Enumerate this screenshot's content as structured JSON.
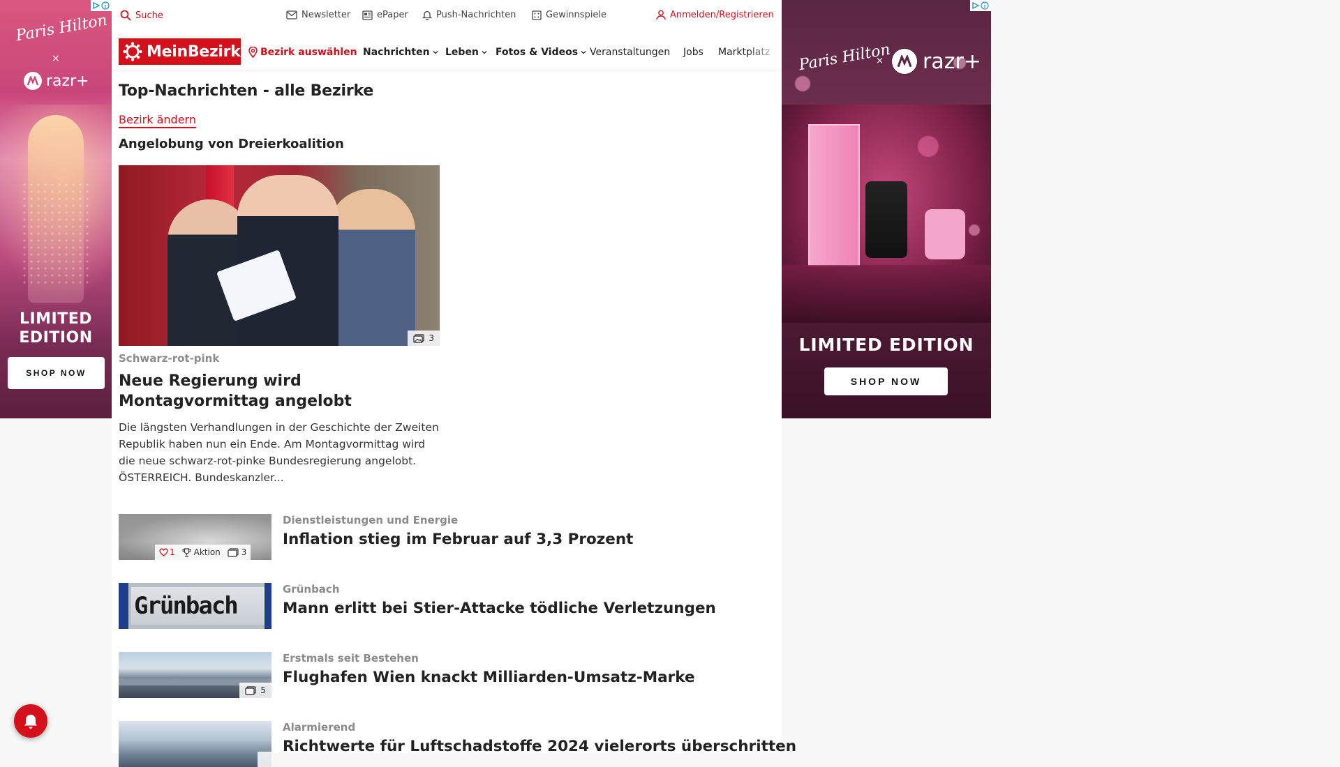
{
  "topbar": {
    "search_label": "Suche",
    "newsletter_label": "Newsletter",
    "epaper_label": "ePaper",
    "push_label": "Push-Nachrichten",
    "gewinnspiele_label": "Gewinnspiele",
    "login_label": "Anmelden/Registrieren"
  },
  "nav": {
    "logo_text": "MeinBezirk",
    "district_select": "Bezirk auswählen",
    "items": [
      "Nachrichten",
      "Leben",
      "Fotos & Videos",
      "Veranstaltungen",
      "Jobs",
      "Marktplatz"
    ]
  },
  "page": {
    "title": "Top-Nachrichten - alle Bezirke",
    "change_district": "Bezirk ändern",
    "section_heading": "Angelobung von Dreierkoalition"
  },
  "lead": {
    "photo_count": "3",
    "kicker": "Schwarz-rot-pink",
    "headline": "Neue Regierung wird Montagvormittag angelobt",
    "teaser": "Die längsten Verhandlungen in der Geschichte der Zweiten Republik haben nun ein Ende. Am Montagvormittag wird die neue schwarz-rot-pinke Bundesregierung angelobt. ÖSTERREICH. Bundeskanzler..."
  },
  "articles": [
    {
      "kicker": "Dienstleistungen und Energie",
      "headline": "Inflation stieg im Februar auf 3,3 Prozent",
      "likes": "1",
      "action_label": "Aktion",
      "photo_count": "3"
    },
    {
      "kicker": "Grünbach",
      "headline": "Mann erlitt bei Stier-Attacke tödliche Verletzungen",
      "thumb_text": "Grünbach"
    },
    {
      "kicker": "Erstmals seit Bestehen",
      "headline": "Flughafen Wien knackt Milliarden-Umsatz-Marke",
      "photo_count": "5"
    },
    {
      "kicker": "Alarmierend",
      "headline": "Richtwerte für Luftschadstoffe 2024 vielerorts überschritten"
    }
  ],
  "ads": {
    "signature": "Paris Hilton",
    "x": "×",
    "brand": "razr+",
    "headline_left_1": "LIMITED",
    "headline_left_2": "EDITION",
    "headline_right": "LIMITED EDITION",
    "cta": "SHOP NOW"
  },
  "colors": {
    "brand_red": "#d4101a",
    "kicker_gray": "#8b8b8b"
  },
  "icons": {
    "search": "search-icon",
    "newsletter": "mail-icon",
    "epaper": "newspaper-icon",
    "push": "bell-icon",
    "gewinnspiele": "gift-icon",
    "login": "user-icon",
    "district": "map-pin-icon",
    "photos": "image-icon",
    "likes": "heart-icon",
    "action": "trophy-icon",
    "notification": "bell-icon"
  }
}
